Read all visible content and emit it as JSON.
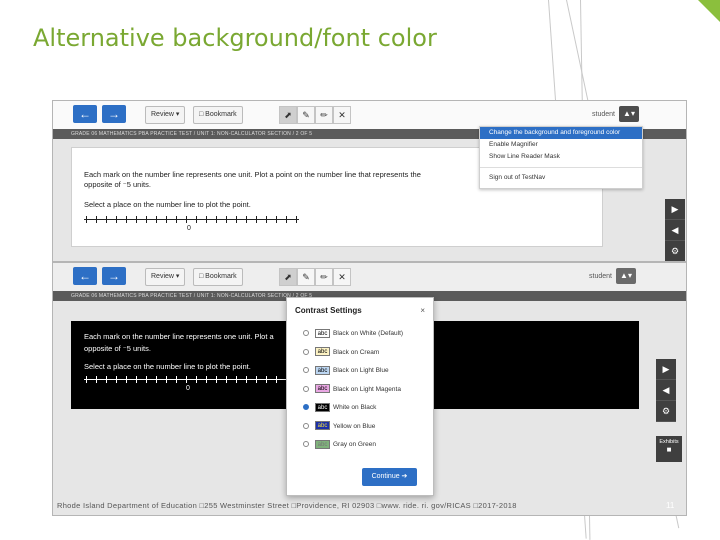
{
  "slide": {
    "title": "Alternative background/font color",
    "footer": "Rhode Island Department of Education □255 Westminster Street □Providence, RI 02903 □www. ride. ri. gov/RICAS □2017-2018",
    "page_number": "11",
    "accent_color": "#7aa832"
  },
  "screen1": {
    "nav": {
      "back_icon": "arrow-left-icon",
      "forward_icon": "arrow-right-icon"
    },
    "review_label": "Review ▾",
    "bookmark_label": "□ Bookmark",
    "tools": [
      "pointer-icon",
      "highlighter-icon",
      "pencil-icon",
      "close-icon"
    ],
    "student_label": "student",
    "user_menu_label": "▲▾",
    "breadcrumb": "GRADE 06 MATHEMATICS PBA PRACTICE TEST   /   UNIT 1: NON-CALCULATOR SECTION   /   2 OF 5",
    "question_line1": "Each mark on the number line represents one unit. Plot a point on the number line that represents the",
    "question_line2": "opposite of ⁻5 units.",
    "instruction": "Select a place on the number line to plot the point.",
    "zero_label": "0",
    "menu": {
      "items": [
        "Change the background and foreground color",
        "Enable Magnifier",
        "Show Line Reader Mask",
        "Sign out of TestNav"
      ]
    },
    "side_tools": [
      "▶",
      "◀",
      "⚙"
    ]
  },
  "screen2": {
    "review_label": "Review ▾",
    "bookmark_label": "□ Bookmark",
    "student_label": "student",
    "user_menu_label": "▲▾",
    "breadcrumb": "GRADE 06 MATHEMATICS PBA PRACTICE TEST   /   UNIT 1: NON-CALCULATOR SECTION   /   2 OF 5",
    "question_line1": "Each mark on the number line represents one unit. Plot a",
    "question_line2": "opposite of ⁻5 units.",
    "instruction": "Select a place on the number line to plot the point.",
    "zero_label": "0",
    "side_tools": [
      "▶",
      "◀",
      "⚙"
    ],
    "exhibits_label": "Exhibits",
    "dialog": {
      "title": "Contrast Settings",
      "close": "×",
      "swatch_text": "abc",
      "selected_index": 4,
      "options": [
        {
          "label": "Black on White (Default)",
          "bg": "#ffffff",
          "fg": "#000000"
        },
        {
          "label": "Black on Cream",
          "bg": "#fdf3c4",
          "fg": "#000000"
        },
        {
          "label": "Black on Light Blue",
          "bg": "#bcd6f2",
          "fg": "#000000"
        },
        {
          "label": "Black on Light Magenta",
          "bg": "#e9a7e3",
          "fg": "#000000"
        },
        {
          "label": "White on Black",
          "bg": "#000000",
          "fg": "#ffffff"
        },
        {
          "label": "Yellow on Blue",
          "bg": "#1b2fa8",
          "fg": "#f5e23a"
        },
        {
          "label": "Gray on Green",
          "bg": "#7fb27b",
          "fg": "#777777"
        }
      ],
      "continue_label": "Continue ➔"
    }
  }
}
